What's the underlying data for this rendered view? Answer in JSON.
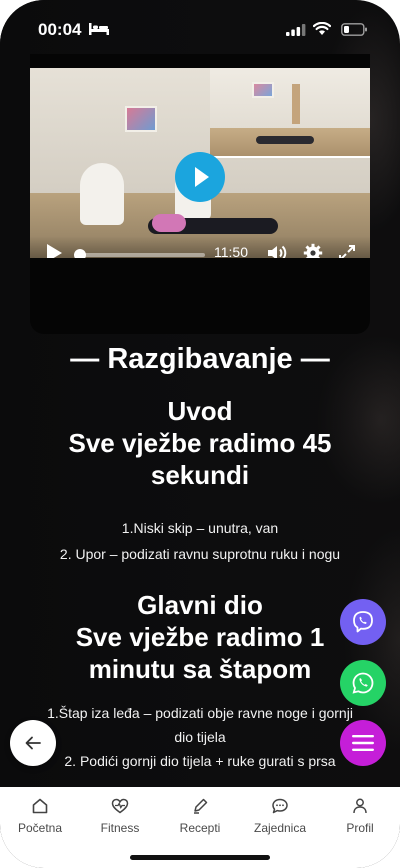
{
  "status_bar": {
    "time": "00:04"
  },
  "video": {
    "duration": "11:50",
    "progress": 0.0
  },
  "content": {
    "section_title": "— Razgibavanje —",
    "intro": {
      "title": "Uvod\nSve vježbe radimo 45 sekundi",
      "title_line1": "Uvod",
      "title_line2": "Sve vježbe radimo 45 sekundi",
      "items": [
        "1.Niski skip – unutra, van",
        "2. Upor – podizati ravnu suprotnu ruku i nogu"
      ]
    },
    "main": {
      "title_line1": "Glavni dio",
      "title_line2": "Sve vježbe radimo 1 minutu sa štapom",
      "items": [
        "1.Štap iza leđa – podizati obje ravne noge i gornji dio tijela",
        "2. Podići gornji dio tijela + ruke gurati s prsa"
      ]
    }
  },
  "fab_colors": {
    "viber": "#7360f2",
    "whatsapp": "#25d366",
    "menu": "#c51ed8"
  },
  "tabbar": {
    "tabs": [
      {
        "label": "Početna",
        "icon": "home-icon"
      },
      {
        "label": "Fitness",
        "icon": "heart-pulse-icon"
      },
      {
        "label": "Recepti",
        "icon": "pen-icon"
      },
      {
        "label": "Zajednica",
        "icon": "chat-icon"
      },
      {
        "label": "Profil",
        "icon": "user-icon"
      }
    ]
  }
}
